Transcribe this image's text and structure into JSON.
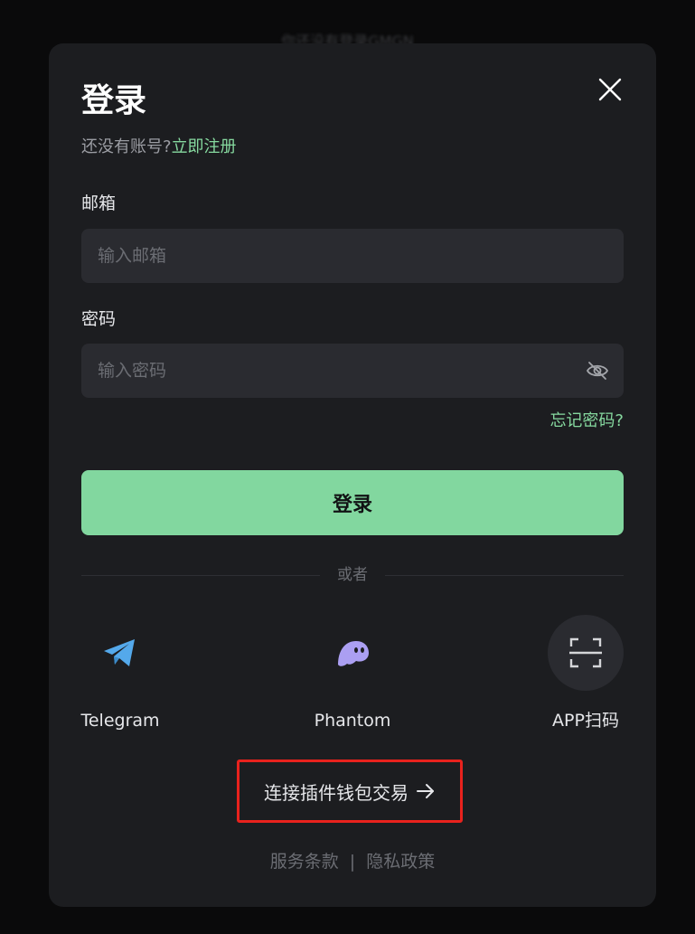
{
  "background": {
    "hint_text": "你还没有登录GMGN"
  },
  "modal": {
    "title": "登录",
    "register_prompt": "还没有账号?",
    "register_link": "立即注册",
    "email": {
      "label": "邮箱",
      "placeholder": "输入邮箱",
      "value": ""
    },
    "password": {
      "label": "密码",
      "placeholder": "输入密码",
      "value": ""
    },
    "forgot_password": "忘记密码?",
    "login_button": "登录",
    "divider_text": "或者",
    "social": [
      {
        "label": "Telegram",
        "icon": "telegram-icon"
      },
      {
        "label": "Phantom",
        "icon": "phantom-icon"
      },
      {
        "label": "APP扫码",
        "icon": "qr-scan-icon"
      }
    ],
    "wallet_link": "连接插件钱包交易",
    "footer": {
      "terms": "服务条款",
      "separator": "|",
      "privacy": "隐私政策"
    }
  },
  "colors": {
    "accent": "#82d79f",
    "link": "#86d99f",
    "modal_bg": "#1c1d20",
    "input_bg": "#2a2b30",
    "highlight_box": "#e8221d"
  }
}
